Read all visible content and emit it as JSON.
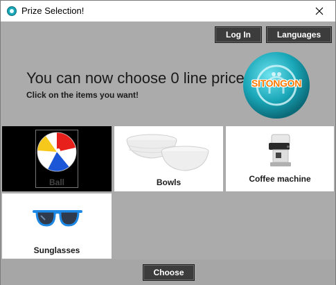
{
  "window": {
    "title": "Prize Selection!"
  },
  "header": {
    "login_label": "Log In",
    "languages_label": "Languages",
    "headline": "You can now choose 0 line prices!",
    "subline": "Click on the items you want!",
    "logo_text": "SITONGON"
  },
  "items": [
    {
      "label": "Ball"
    },
    {
      "label": "Bowls"
    },
    {
      "label": "Coffee machine"
    },
    {
      "label": "Sunglasses"
    }
  ],
  "footer": {
    "choose_label": "Choose"
  },
  "colors": {
    "accent_button": "#3c3c3c",
    "logo_teal": "#1aa7b8",
    "logo_orange": "#ff7a00"
  },
  "icons": [
    "app-icon",
    "close-icon",
    "ball-image",
    "bowls-image",
    "coffee-machine-image",
    "sunglasses-image",
    "logo-icon"
  ]
}
